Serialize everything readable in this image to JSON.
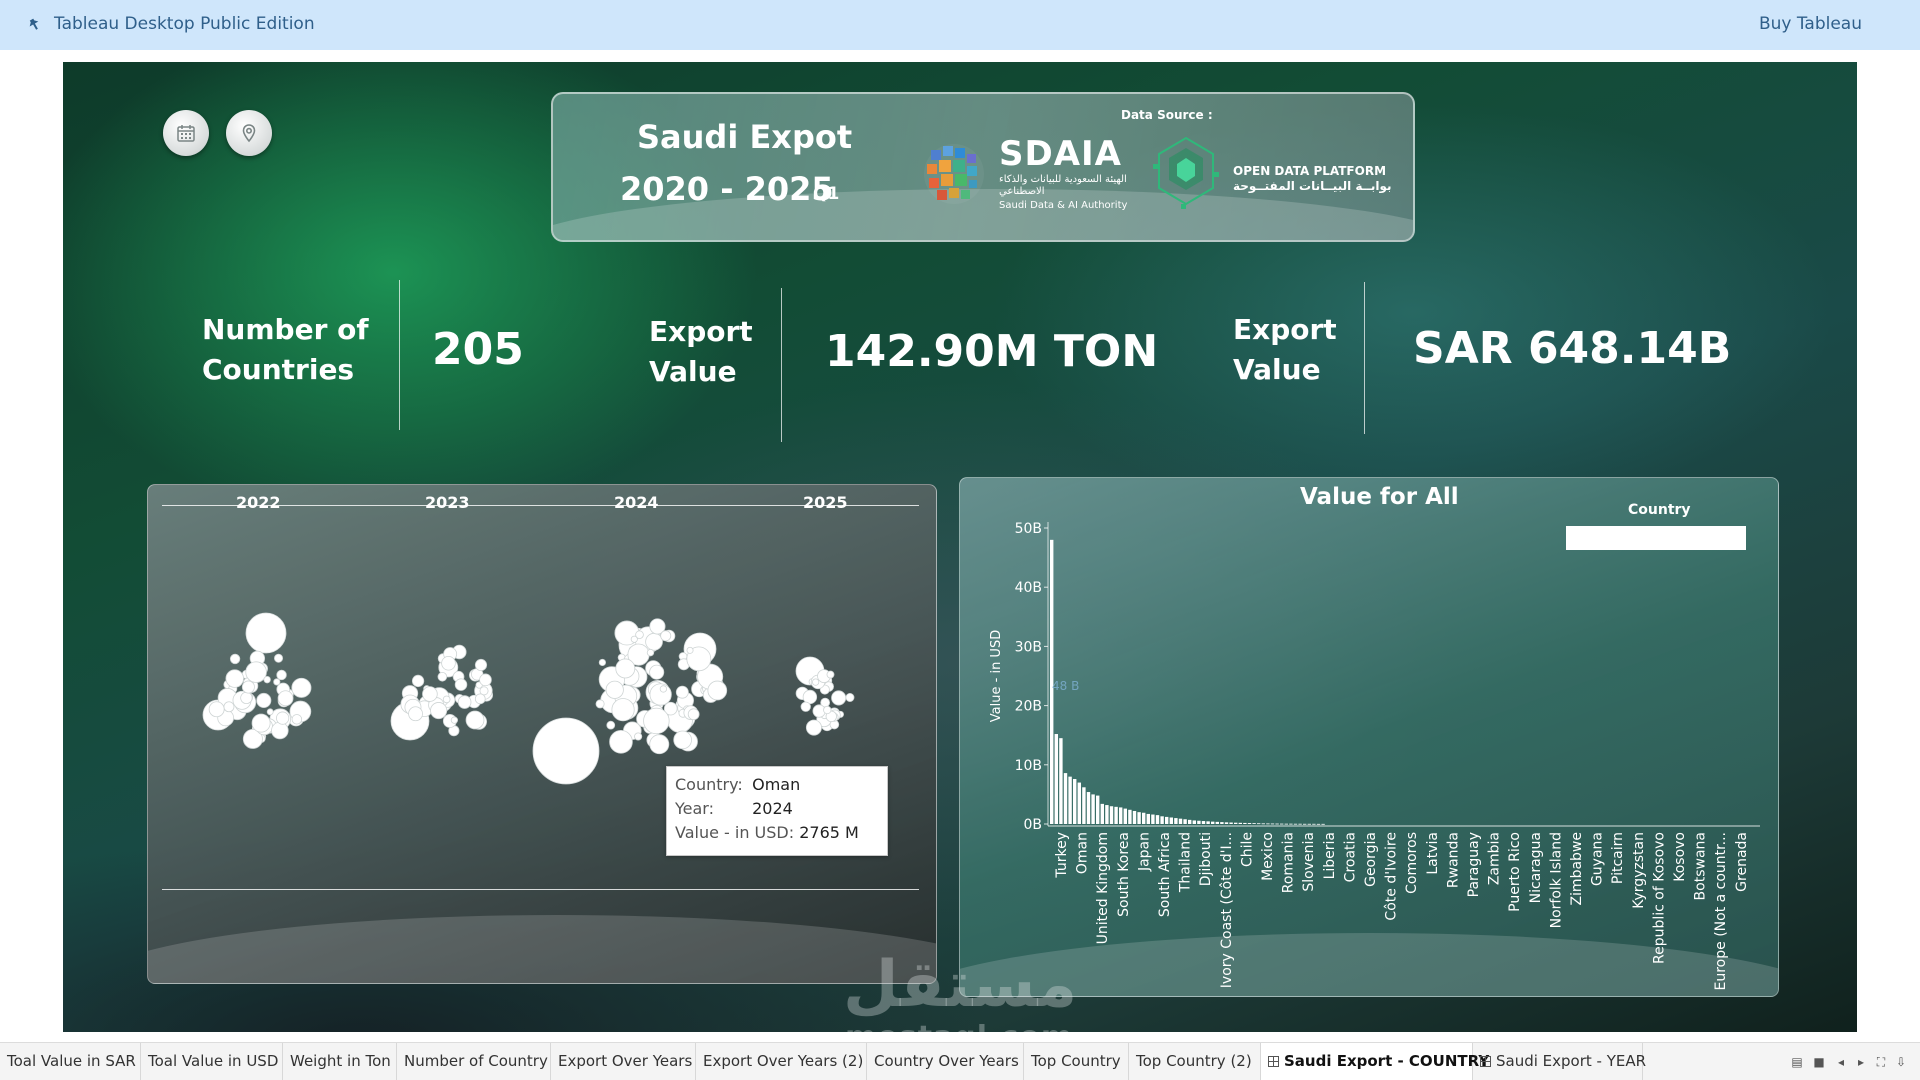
{
  "app": {
    "title": "Tableau Desktop Public Edition",
    "buy_label": "Buy Tableau"
  },
  "icons": {
    "calendar": "calendar-icon",
    "location": "location-pin-icon"
  },
  "header": {
    "title": "Saudi Expot",
    "years": "2020 - 2025",
    "quarter": "Q1",
    "data_source_label": "Data Source :",
    "sdaia_name": "SDAIA",
    "sdaia_arabic": "الهيئة السعودية للبيانات والذكاء الاصطناعي",
    "sdaia_english": "Saudi Data & AI Authority",
    "odp_english": "OPEN DATA PLATFORM",
    "odp_arabic": "بوابــة البيــانات المفتــوحة"
  },
  "kpis": [
    {
      "label": "Number of Countries",
      "value": "205"
    },
    {
      "label": "Export Value",
      "value": "142.90M TON"
    },
    {
      "label": "Export Value",
      "value": "SAR 648.14B"
    }
  ],
  "bubble_panel": {
    "years": [
      "2022",
      "2023",
      "2024",
      "2025"
    ],
    "tooltip": {
      "country_label": "Country:",
      "country_value": "Oman",
      "year_label": "Year:",
      "year_value": "2024",
      "value_label": "Value - in USD:",
      "value_value": "2765 M"
    }
  },
  "chart_data": {
    "type": "bar",
    "title": "Value for  All",
    "ylabel": "Value - in USD",
    "xlabel": "",
    "ylim": [
      0,
      50
    ],
    "yticks": [
      "0B",
      "10B",
      "20B",
      "30B",
      "40B",
      "50B"
    ],
    "legend_title": "Country",
    "annotation": "48 B",
    "labeled_categories": [
      "Turkey",
      "Oman",
      "United Kingdom",
      "South Korea",
      "Japan",
      "South Africa",
      "Thailand",
      "Djibouti",
      "Ivory Coast (Côte d'I...",
      "Chile",
      "Mexico",
      "Romania",
      "Slovenia",
      "Liberia",
      "Croatia",
      "Georgia",
      "Côte d'Ivoire",
      "Comoros",
      "Latvia",
      "Rwanda",
      "Paraguay",
      "Zambia",
      "Puerto Rico",
      "Nicaragua",
      "Norfolk Island",
      "Zimbabwe",
      "Guyana",
      "Pitcairn",
      "Kyrgyzstan",
      "Republic of Kosovo",
      "Kosovo",
      "Botswana",
      "Europe (Not a countr...",
      "Grenada"
    ],
    "values": [
      48,
      15.2,
      14.5,
      8.6,
      8.0,
      7.6,
      7.0,
      6.2,
      5.4,
      5.0,
      4.8,
      3.4,
      3.2,
      3.0,
      2.9,
      2.8,
      2.6,
      2.4,
      2.2,
      2.0,
      1.9,
      1.7,
      1.6,
      1.5,
      1.3,
      1.2,
      1.1,
      1.0,
      0.9,
      0.8,
      0.7,
      0.6,
      0.55,
      0.5,
      0.45,
      0.4,
      0.36,
      0.32,
      0.28,
      0.25,
      0.22,
      0.2,
      0.18,
      0.16,
      0.14,
      0.12,
      0.1,
      0.09,
      0.08,
      0.07,
      0.06,
      0.05,
      0.05,
      0.04,
      0.04,
      0.03,
      0.03,
      0.03,
      0.02,
      0.02
    ]
  },
  "watermark": {
    "arabic": "مستقل",
    "latin": "mostaql.com"
  },
  "tabs": [
    {
      "label": "Toal Value in SAR",
      "active": false,
      "dashboard": false
    },
    {
      "label": "Toal Value in USD",
      "active": false,
      "dashboard": false
    },
    {
      "label": "Weight in Ton",
      "active": false,
      "dashboard": false
    },
    {
      "label": "Number of Country",
      "active": false,
      "dashboard": false
    },
    {
      "label": "Export Over Years",
      "active": false,
      "dashboard": false
    },
    {
      "label": "Export Over Years (2)",
      "active": false,
      "dashboard": false
    },
    {
      "label": "Country Over Years",
      "active": false,
      "dashboard": false
    },
    {
      "label": "Top Country",
      "active": false,
      "dashboard": false
    },
    {
      "label": "Top Country (2)",
      "active": false,
      "dashboard": false
    },
    {
      "label": "Saudi Export - COUNTRY",
      "active": true,
      "dashboard": true
    },
    {
      "label": "Saudi Export - YEAR",
      "active": false,
      "dashboard": true
    }
  ],
  "colors": {
    "topbar": "#cfe6fb",
    "topbar_text": "#2f5f8a",
    "bars": "#ffffff"
  }
}
